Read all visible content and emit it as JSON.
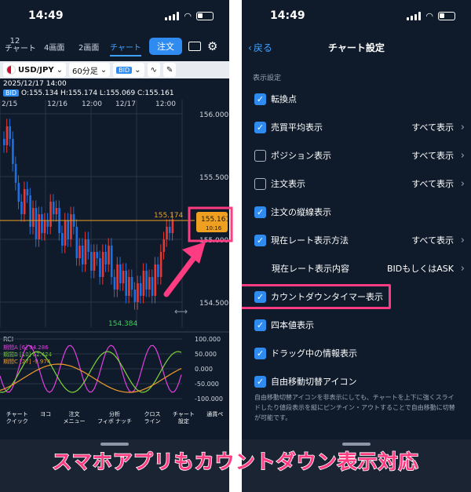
{
  "status_time": "14:49",
  "left": {
    "tabs": [
      {
        "label": "12\nチャート"
      },
      {
        "label": "4画面"
      },
      {
        "label": "2画面"
      },
      {
        "label": "チャート"
      }
    ],
    "order_label": "注文",
    "toolbar": {
      "pair": "USD/JPY",
      "interval": "60分足",
      "bid": "BID"
    },
    "info_date": "2025/12/17 14:00",
    "ohlc": "O:155.134  H:155.174  L:155.069  C:155.161",
    "xaxis": [
      "2/15",
      "12/16",
      "12:00",
      "12/17",
      "12:00"
    ],
    "yaxis": [
      "156.000",
      "155.500",
      "155.000",
      "154.500"
    ],
    "price_label": "155.174",
    "current_rate": "155.161",
    "countdown": "10:16",
    "low_label": "154.384",
    "rci": {
      "title": "RCI",
      "lines": [
        {
          "name": "期間A",
          "param": "[6]",
          "value": "94.286",
          "color": "#e040e0"
        },
        {
          "name": "期間B",
          "param": "[10]",
          "value": "62.424",
          "color": "#7fd43a"
        },
        {
          "name": "期間C",
          "param": "[27]",
          "value": "-9.974",
          "color": "#f09a2a"
        }
      ],
      "yaxis": [
        "100.000",
        "50.000",
        "0.000",
        "-50.000",
        "-100.000"
      ]
    },
    "bottom_menu": [
      "チャート\nクイック",
      "ヨコ",
      "注文\nメニュー",
      "分析\nフィボ ナッチ",
      "クロス\nライン",
      "チャート\n設定",
      "通貨ペ"
    ]
  },
  "right": {
    "back_label": "戻る",
    "title": "チャート設定",
    "section": "表示設定",
    "rows": [
      {
        "label": "転換点",
        "checked": true,
        "value": ""
      },
      {
        "label": "売買平均表示",
        "checked": true,
        "value": "すべて表示"
      },
      {
        "label": "ポジション表示",
        "checked": false,
        "value": "すべて表示"
      },
      {
        "label": "注文表示",
        "checked": false,
        "value": "すべて表示"
      },
      {
        "label": "注文の縦線表示",
        "checked": true,
        "value": ""
      },
      {
        "label": "現在レート表示方法",
        "checked": true,
        "value": "すべて表示"
      },
      {
        "label": "現在レート表示内容",
        "checked": null,
        "value": "BIDもしくはASK"
      },
      {
        "label": "カウントダウンタイマー表示",
        "checked": true,
        "value": ""
      },
      {
        "label": "四本値表示",
        "checked": true,
        "value": ""
      },
      {
        "label": "ドラッグ中の情報表示",
        "checked": true,
        "value": ""
      },
      {
        "label": "自由移動切替アイコン",
        "checked": true,
        "value": ""
      }
    ],
    "footnote": "自由移動切替アイコンを非表示にしても、チャートを上下に強くスライドしたり値段表示を縦にピンチイン・アウトすることで自由移動に切替が可能です。"
  },
  "banner": "スマホアプリもカウントダウン表示対応",
  "colors": {
    "bg": "#0f1b2b",
    "accent": "#2f8bf0",
    "highlight": "#ff3b82",
    "candle_up": "#e53935",
    "candle_down": "#1e6fe0",
    "current_line": "#f0a020"
  }
}
